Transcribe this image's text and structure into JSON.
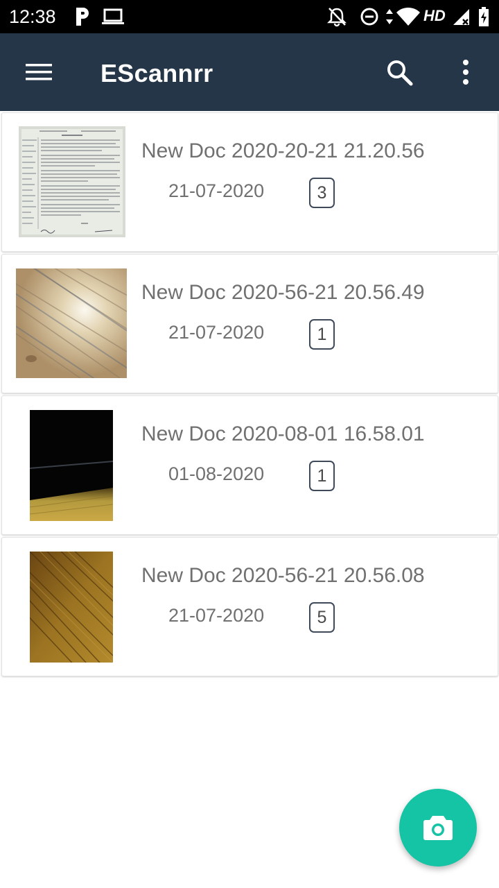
{
  "status_bar": {
    "time": "12:38",
    "network_label": "HD",
    "icons": [
      "parking-icon",
      "laptop-icon",
      "notifications-off-icon",
      "do-not-disturb-icon",
      "data-arrows-icon",
      "wifi-icon",
      "cell-signal-icon",
      "battery-charging-icon"
    ]
  },
  "app_bar": {
    "title": "EScannrr",
    "icons": [
      "menu-icon",
      "search-icon",
      "more-vert-icon"
    ],
    "background": "#253649"
  },
  "documents": [
    {
      "title": "New Doc 2020-20-21 21.20.56",
      "date": "21-07-2020",
      "pages": "3",
      "thumbnail": "scanned-paper"
    },
    {
      "title": "New Doc 2020-56-21 20.56.49",
      "date": "21-07-2020",
      "pages": "1",
      "thumbnail": "light-wood-surface"
    },
    {
      "title": "New Doc 2020-08-01 16.58.01",
      "date": "01-08-2020",
      "pages": "1",
      "thumbnail": "dark-photo"
    },
    {
      "title": "New Doc 2020-56-21 20.56.08",
      "date": "21-07-2020",
      "pages": "5",
      "thumbnail": "wood-grain"
    }
  ],
  "fab": {
    "icon": "camera-icon",
    "color": "#14c4a4"
  }
}
